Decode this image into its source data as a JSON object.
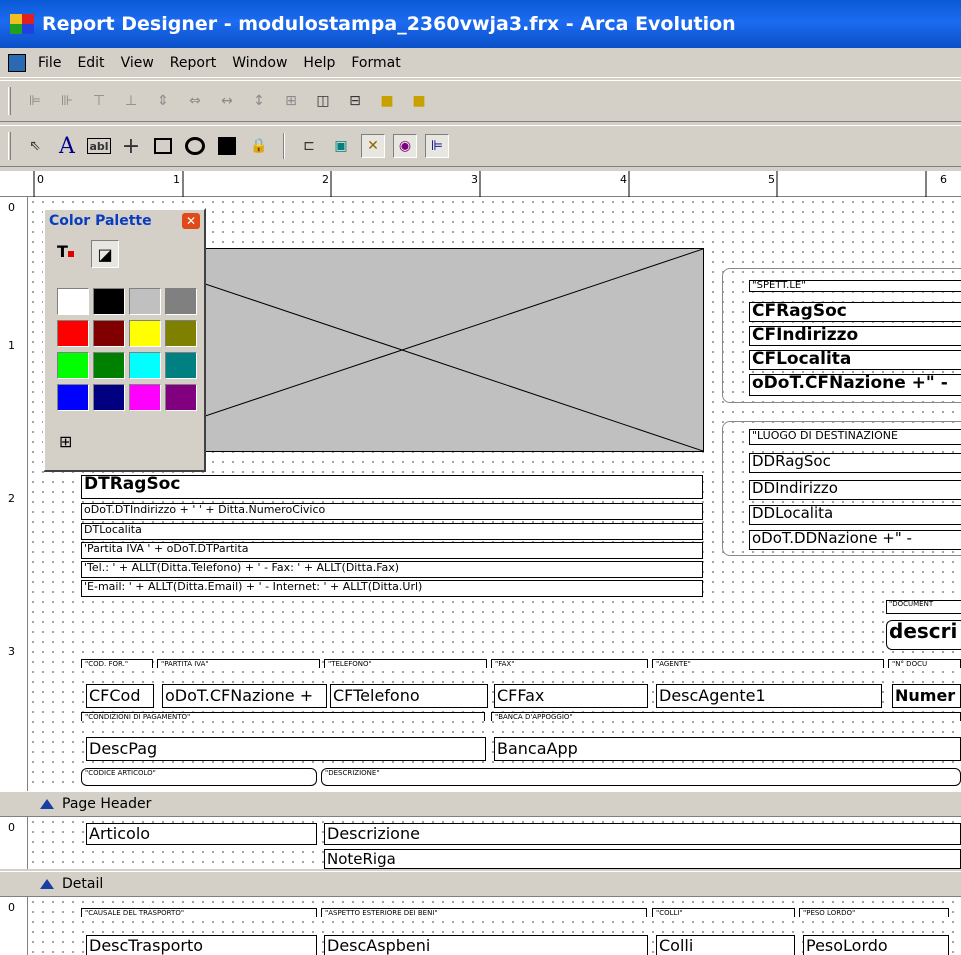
{
  "window": {
    "title": "Report Designer - modulostampa_2360vwja3.frx - Arca Evolution"
  },
  "menu": [
    "File",
    "Edit",
    "View",
    "Report",
    "Window",
    "Help",
    "Format"
  ],
  "palette": {
    "title": "Color Palette",
    "colors": [
      "#ffffff",
      "#000000",
      "#c0c0c0",
      "#808080",
      "#ff0000",
      "#800000",
      "#ffff00",
      "#808000",
      "#00ff00",
      "#008000",
      "#00ffff",
      "#008080",
      "#0000ff",
      "#000080",
      "#ff00ff",
      "#800080"
    ]
  },
  "ruler": {
    "h": [
      "0",
      "1",
      "2",
      "3",
      "4",
      "5",
      "6"
    ],
    "v": [
      "0",
      "1",
      "2",
      "3"
    ]
  },
  "bands": {
    "page_header": "Page Header",
    "detail": "Detail",
    "detail_ruler": "0",
    "footer_ruler": "0"
  },
  "header": {
    "spett": "\"SPETT.LE\"",
    "cfragsoc": "CFRagSoc",
    "cfindirizzo": "CFIndirizzo",
    "cflocalita": "CFLocalita",
    "cfnazione": "oDoT.CFNazione +\" -",
    "luogo": "\"LUOGO DI DESTINAZIONE",
    "ddragsoc": "DDRagSoc",
    "ddindirizzo": "DDIndirizzo",
    "ddlocalita": "DDLocalita",
    "ddnazione": "oDoT.DDNazione +\" -",
    "dtragsoc": "DTRagSoc",
    "dtindirizzo": "oDoT.DTIndirizzo + ' ' + Ditta.NumeroCivico",
    "dtlocalita": "DTLocalita",
    "piva": "'Partita IVA ' + oDoT.DTPartita",
    "tel": "'Tel.: ' + ALLT(Ditta.Telefono) + ' - Fax: ' + ALLT(Ditta.Fax)",
    "email": "'E-mail: ' + ALLT(Ditta.Email) + ' - Internet: ' + ALLT(Ditta.Url)",
    "documento": "\"DOCUMENT",
    "descri": "descri",
    "cap_cod": "\"COD. FOR.\"",
    "cap_piva": "\"PARTITA IVA\"",
    "cap_tel": "\"TELEFONO\"",
    "cap_fax": "\"FAX\"",
    "cap_agente": "\"AGENTE\"",
    "cap_ndoc": "\"N° DOCU",
    "cfcod": "CFCod",
    "cfnazione2": "oDoT.CFNazione +",
    "cftelefono": "CFTelefono",
    "cffax": "CFFax",
    "descagente": "DescAgente1",
    "numer": "Numer",
    "cap_cond": "\"CONDIZIONI DI PAGAMENTO\"",
    "cap_banca": "\"BANCA D'APPOGGIO\"",
    "descpag": "DescPag",
    "bancaapp": "BancaApp",
    "cap_codart": "\"CODICE ARTICOLO\"",
    "cap_descr": "\"DESCRIZIONE\""
  },
  "detail": {
    "articolo": "Articolo",
    "descrizione": "Descrizione",
    "noteriga": "NoteRiga"
  },
  "footer": {
    "cap_causale": "\"CAUSALE DEL TRASPORTO\"",
    "cap_aspetto": "\"ASPETTO ESTERIORE DEI BENI\"",
    "cap_colli": "\"COLLI\"",
    "cap_peso": "\"PESO LORDO\"",
    "desctrasporto": "DescTrasporto",
    "descaspbeni": "DescAspbeni",
    "colli": "Colli",
    "pesolordo": "PesoLordo"
  }
}
